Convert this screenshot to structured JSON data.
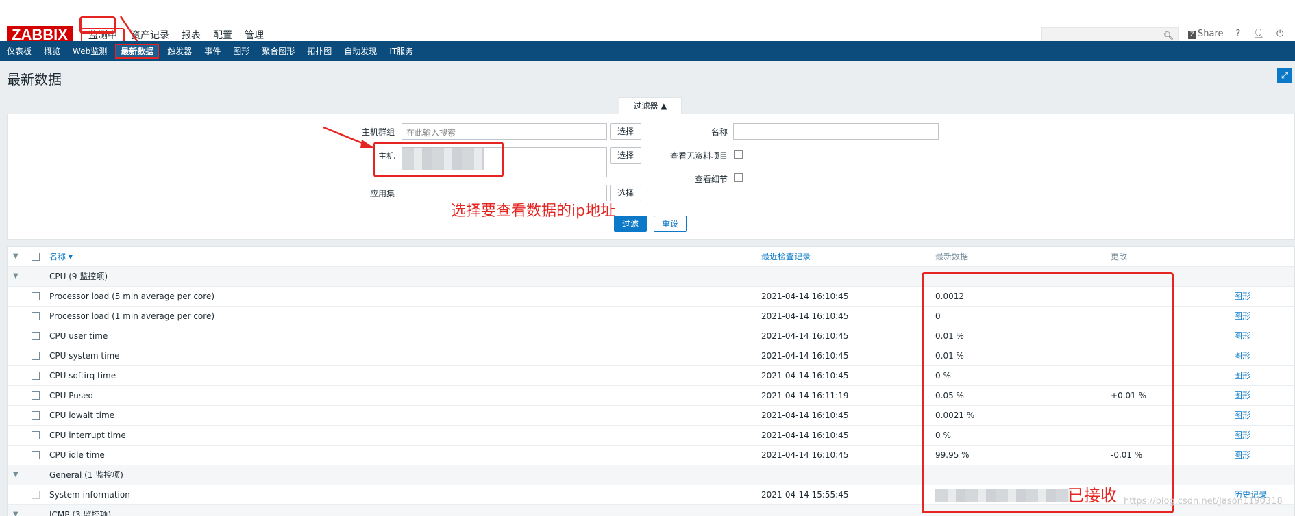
{
  "header": {
    "logo": "ZABBIX",
    "main_nav": [
      {
        "label": "监测中",
        "active": true
      },
      {
        "label": "资产记录",
        "active": false
      },
      {
        "label": "报表",
        "active": false
      },
      {
        "label": "配置",
        "active": false
      },
      {
        "label": "管理",
        "active": false
      }
    ],
    "share_label": "Share",
    "help_label": "?"
  },
  "subnav": [
    {
      "label": "仪表板",
      "active": false
    },
    {
      "label": "概览",
      "active": false
    },
    {
      "label": "Web监测",
      "active": false
    },
    {
      "label": "最新数据",
      "active": true
    },
    {
      "label": "触发器",
      "active": false
    },
    {
      "label": "事件",
      "active": false
    },
    {
      "label": "图形",
      "active": false
    },
    {
      "label": "聚合图形",
      "active": false
    },
    {
      "label": "拓扑图",
      "active": false
    },
    {
      "label": "自动发现",
      "active": false
    },
    {
      "label": "IT服务",
      "active": false
    }
  ],
  "page": {
    "title": "最新数据"
  },
  "filter": {
    "tab_label": "过滤器 ▲",
    "host_group_label": "主机群组",
    "host_group_placeholder": "在此输入搜索",
    "host_label": "主机",
    "app_label": "应用集",
    "select_label": "选择",
    "name_label": "名称",
    "show_no_data_label": "查看无资料项目",
    "show_details_label": "查看细节",
    "apply_label": "过滤",
    "reset_label": "重设"
  },
  "annotations": {
    "select_ip_note": "选择要查看数据的ip地址",
    "received_note": "已接收"
  },
  "table": {
    "col_name": "名称 ▾",
    "col_last_check": "最近检查记录",
    "col_last_value": "最新数据",
    "col_change": "更改",
    "groups": [
      {
        "name": "CPU",
        "count": "(9 监控项)",
        "items": [
          {
            "name": "Processor load (5 min average per core)",
            "time": "2021-04-14 16:10:45",
            "value": "0.0012",
            "change": "",
            "action": "图形"
          },
          {
            "name": "Processor load (1 min average per core)",
            "time": "2021-04-14 16:10:45",
            "value": "0",
            "change": "",
            "action": "图形"
          },
          {
            "name": "CPU user time",
            "time": "2021-04-14 16:10:45",
            "value": "0.01 %",
            "change": "",
            "action": "图形"
          },
          {
            "name": "CPU system time",
            "time": "2021-04-14 16:10:45",
            "value": "0.01 %",
            "change": "",
            "action": "图形"
          },
          {
            "name": "CPU softirq time",
            "time": "2021-04-14 16:10:45",
            "value": "0 %",
            "change": "",
            "action": "图形"
          },
          {
            "name": "CPU Pused",
            "time": "2021-04-14 16:11:19",
            "value": "0.05 %",
            "change": "+0.01 %",
            "action": "图形"
          },
          {
            "name": "CPU iowait time",
            "time": "2021-04-14 16:10:45",
            "value": "0.0021 %",
            "change": "",
            "action": "图形"
          },
          {
            "name": "CPU interrupt time",
            "time": "2021-04-14 16:10:45",
            "value": "0 %",
            "change": "",
            "action": "图形"
          },
          {
            "name": "CPU idle time",
            "time": "2021-04-14 16:10:45",
            "value": "99.95 %",
            "change": "-0.01 %",
            "action": "图形"
          }
        ]
      },
      {
        "name": "General",
        "count": "(1 监控项)",
        "items": [
          {
            "name": "System information",
            "time": "2021-04-14 15:55:45",
            "value": "",
            "change": "",
            "action": "历史记录"
          }
        ]
      },
      {
        "name": "ICMP",
        "count": "(3 监控项)",
        "items": []
      }
    ]
  },
  "watermark": "https://blog.csdn.net/Jason1190318"
}
